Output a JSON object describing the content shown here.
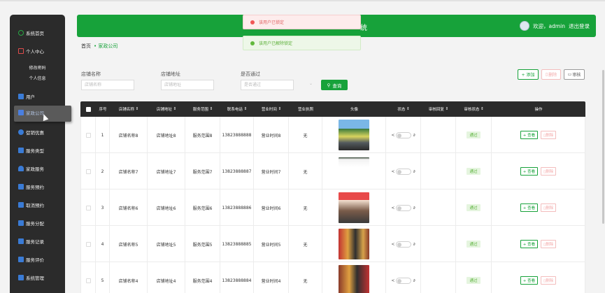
{
  "sidebar": {
    "items": [
      {
        "label": "系统首页",
        "icon": "home-icon",
        "color": "#27a844"
      },
      {
        "label": "个人中心",
        "icon": "calendar-icon",
        "color": "#e04c4c"
      },
      {
        "label": "用户",
        "icon": "grid-icon",
        "color": "#3a7bd5"
      },
      {
        "label": "家政公司",
        "icon": "doc-icon",
        "color": "#3a7bd5"
      },
      {
        "label": "促销优惠",
        "icon": "user-icon",
        "color": "#3a7bd5"
      },
      {
        "label": "服务类型",
        "icon": "list-icon",
        "color": "#3a7bd5"
      },
      {
        "label": "家政服务",
        "icon": "person-icon",
        "color": "#3a7bd5"
      },
      {
        "label": "服务预约",
        "icon": "menu-icon",
        "color": "#3a7bd5"
      },
      {
        "label": "取消预约",
        "icon": "grid-icon",
        "color": "#3a7bd5"
      },
      {
        "label": "服务分配",
        "icon": "clipboard-icon",
        "color": "#3a7bd5"
      },
      {
        "label": "服务记录",
        "icon": "chart-icon",
        "color": "#3a7bd5"
      },
      {
        "label": "服务评价",
        "icon": "flag-icon",
        "color": "#3a7bd5"
      },
      {
        "label": "系统管理",
        "icon": "table-icon",
        "color": "#3a7bd5"
      }
    ],
    "subitems": [
      "修改密码",
      "个人信息"
    ]
  },
  "header": {
    "title_tail": "统",
    "welcome": "欢迎，admin",
    "logout": "退出登录"
  },
  "toasts": {
    "error": "该用户已锁定",
    "success": "该用户已解除锁定"
  },
  "breadcrumb": {
    "home": "首页",
    "current": "家政公司"
  },
  "filters": {
    "store_name_label": "店铺名称",
    "store_name_placeholder": "店铺名称",
    "store_addr_label": "店铺地址",
    "store_addr_placeholder": "店铺地址",
    "approved_label": "是否通过",
    "approved_placeholder": "是否通过",
    "query": "查询"
  },
  "toolbar": {
    "add": "+ 添加",
    "delete": "删除",
    "audit": "审核"
  },
  "table": {
    "headers": [
      "序号",
      "店铺名称",
      "店铺地址",
      "服务范围",
      "联系电话",
      "营业时间",
      "营业执照",
      "头像",
      "状态",
      "审核回复",
      "审核状态",
      "操作"
    ],
    "rows": [
      {
        "no": "1",
        "name": "店铺名称8",
        "addr": "店铺地址8",
        "scope": "服务范围8",
        "phone": "13823888888",
        "hours": "营业时间8",
        "license": "无",
        "audit_status": "通过"
      },
      {
        "no": "2",
        "name": "店铺名称7",
        "addr": "店铺地址7",
        "scope": "服务范围7",
        "phone": "13823888887",
        "hours": "营业时间7",
        "license": "无",
        "audit_status": "通过"
      },
      {
        "no": "3",
        "name": "店铺名称6",
        "addr": "店铺地址6",
        "scope": "服务范围6",
        "phone": "13823888886",
        "hours": "营业时间6",
        "license": "无",
        "audit_status": "通过"
      },
      {
        "no": "4",
        "name": "店铺名称5",
        "addr": "店铺地址5",
        "scope": "服务范围5",
        "phone": "13823888885",
        "hours": "营业时间5",
        "license": "无",
        "audit_status": "通过"
      },
      {
        "no": "5",
        "name": "店铺名称4",
        "addr": "店铺地址4",
        "scope": "服务范围4",
        "phone": "13823888884",
        "hours": "营业时间4",
        "license": "无",
        "audit_status": "通过"
      }
    ],
    "view_label": "+ 查看",
    "delete_label": "删除"
  }
}
